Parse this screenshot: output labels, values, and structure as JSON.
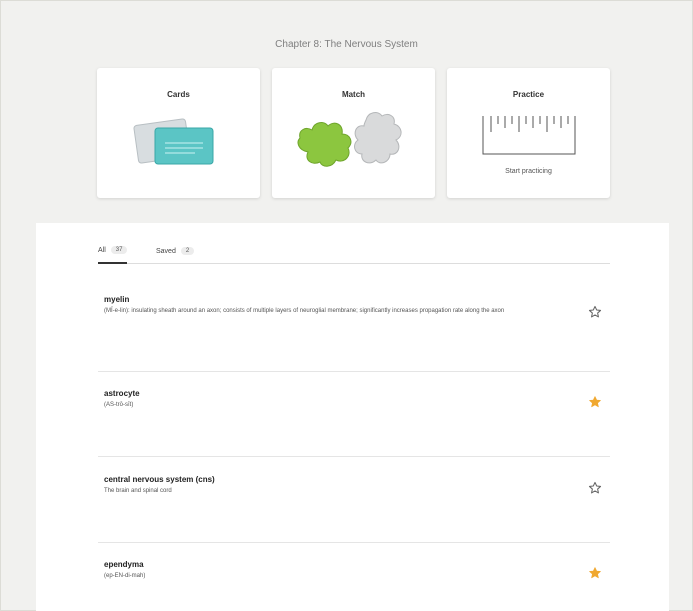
{
  "header": {
    "chapter_title": "Chapter 8: The Nervous System"
  },
  "modes": [
    {
      "title": "Cards",
      "subtitle": "",
      "icon": "flashcards-icon"
    },
    {
      "title": "Match",
      "subtitle": "",
      "icon": "puzzle-icon"
    },
    {
      "title": "Practice",
      "subtitle": "Start practicing",
      "icon": "ruler-icon"
    }
  ],
  "tabs": [
    {
      "label": "All",
      "count": "37"
    },
    {
      "label": "Saved",
      "count": "2"
    }
  ],
  "terms": [
    {
      "term": "myelin",
      "definition": "(MÏ-e-lin): insulating sheath around an axon; consists of multiple layers of neuroglial membrane; significantly increases propagation rate along the axon",
      "saved": false
    },
    {
      "term": "astrocyte",
      "definition": "(AS-trō-sīt)",
      "saved": true
    },
    {
      "term": "central nervous system (cns)",
      "definition": "The brain and spinal cord",
      "saved": false
    },
    {
      "term": "ependyma",
      "definition": "(ep-EN-di-mah)",
      "saved": true
    }
  ],
  "colors": {
    "star_filled": "#f0a830",
    "star_outline": "#666666",
    "match_green": "#8cc63f",
    "card_teal": "#5bc5c5"
  }
}
